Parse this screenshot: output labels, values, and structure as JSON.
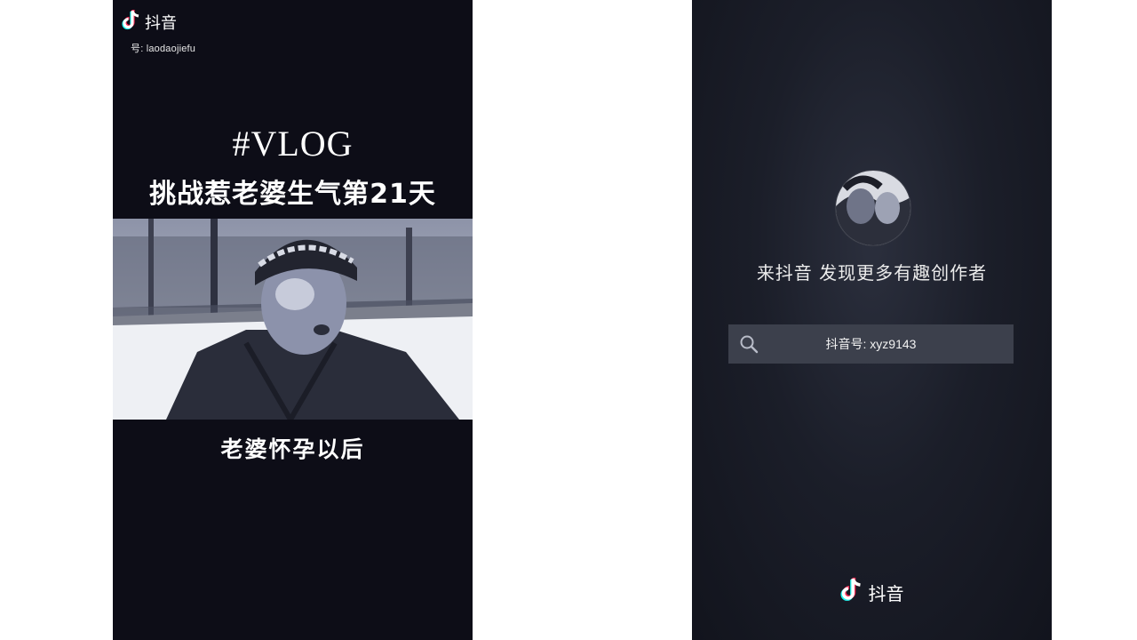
{
  "watermark": {
    "app_name": "抖音",
    "account_id": "号: laodaojiefu",
    "logo_icon": "douyin-note-icon"
  },
  "video": {
    "tag": "#VLOG",
    "title": "挑战惹老婆生气第21天",
    "caption": "老婆怀孕以后"
  },
  "end_card": {
    "slogan": "来抖音 发现更多有趣创作者",
    "search_text": "抖音号: xyz9143",
    "search_icon": "search-icon",
    "logo_text": "抖音"
  },
  "colors": {
    "panel_bg": "#0d0d17",
    "end_card_bg": "#1b1e29",
    "search_bg": "#3c404c",
    "text": "#ffffff"
  }
}
